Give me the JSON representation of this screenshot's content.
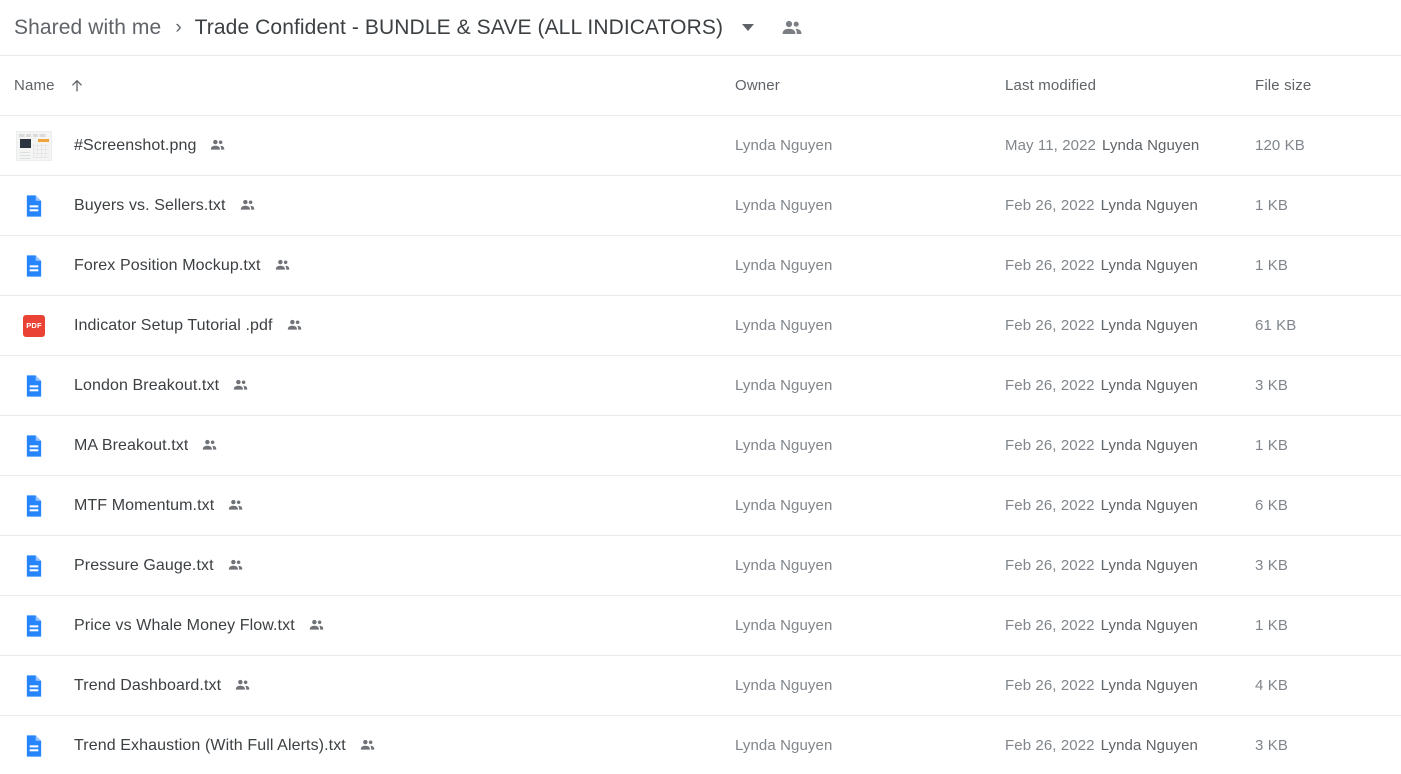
{
  "breadcrumb": {
    "parent": "Shared with me",
    "separator": "›",
    "current": "Trade Confident - BUNDLE & SAVE (ALL INDICATORS)",
    "caret_icon": "chevron-down-icon",
    "people_icon": "people-shared-icon"
  },
  "table": {
    "columns": {
      "name": "Name",
      "owner": "Owner",
      "last_modified": "Last modified",
      "file_size": "File size"
    },
    "sort": {
      "column": "Name",
      "direction": "ascending",
      "icon": "arrow-up-icon"
    },
    "rows": [
      {
        "name": "#Screenshot.png",
        "icon": "image-thumbnail",
        "shared_icon": "people-shared-icon",
        "owner": "Lynda Nguyen",
        "modified_date": "May 11, 2022",
        "modified_by": "Lynda Nguyen",
        "size": "120 KB"
      },
      {
        "name": "Buyers vs. Sellers.txt",
        "icon": "text-file-icon",
        "shared_icon": "people-shared-icon",
        "owner": "Lynda Nguyen",
        "modified_date": "Feb 26, 2022",
        "modified_by": "Lynda Nguyen",
        "size": "1 KB"
      },
      {
        "name": "Forex Position Mockup.txt",
        "icon": "text-file-icon",
        "shared_icon": "people-shared-icon",
        "owner": "Lynda Nguyen",
        "modified_date": "Feb 26, 2022",
        "modified_by": "Lynda Nguyen",
        "size": "1 KB"
      },
      {
        "name": "Indicator Setup Tutorial .pdf",
        "icon": "pdf-file-icon",
        "icon_label": "PDF",
        "shared_icon": "people-shared-icon",
        "owner": "Lynda Nguyen",
        "modified_date": "Feb 26, 2022",
        "modified_by": "Lynda Nguyen",
        "size": "61 KB"
      },
      {
        "name": "London Breakout.txt",
        "icon": "text-file-icon",
        "shared_icon": "people-shared-icon",
        "owner": "Lynda Nguyen",
        "modified_date": "Feb 26, 2022",
        "modified_by": "Lynda Nguyen",
        "size": "3 KB"
      },
      {
        "name": "MA Breakout.txt",
        "icon": "text-file-icon",
        "shared_icon": "people-shared-icon",
        "owner": "Lynda Nguyen",
        "modified_date": "Feb 26, 2022",
        "modified_by": "Lynda Nguyen",
        "size": "1 KB"
      },
      {
        "name": "MTF Momentum.txt",
        "icon": "text-file-icon",
        "shared_icon": "people-shared-icon",
        "owner": "Lynda Nguyen",
        "modified_date": "Feb 26, 2022",
        "modified_by": "Lynda Nguyen",
        "size": "6 KB"
      },
      {
        "name": "Pressure Gauge.txt",
        "icon": "text-file-icon",
        "shared_icon": "people-shared-icon",
        "owner": "Lynda Nguyen",
        "modified_date": "Feb 26, 2022",
        "modified_by": "Lynda Nguyen",
        "size": "3 KB"
      },
      {
        "name": "Price vs Whale Money Flow.txt",
        "icon": "text-file-icon",
        "shared_icon": "people-shared-icon",
        "owner": "Lynda Nguyen",
        "modified_date": "Feb 26, 2022",
        "modified_by": "Lynda Nguyen",
        "size": "1 KB"
      },
      {
        "name": "Trend Dashboard.txt",
        "icon": "text-file-icon",
        "shared_icon": "people-shared-icon",
        "owner": "Lynda Nguyen",
        "modified_date": "Feb 26, 2022",
        "modified_by": "Lynda Nguyen",
        "size": "4 KB"
      },
      {
        "name": "Trend Exhaustion (With Full Alerts).txt",
        "icon": "text-file-icon",
        "shared_icon": "people-shared-icon",
        "owner": "Lynda Nguyen",
        "modified_date": "Feb 26, 2022",
        "modified_by": "Lynda Nguyen",
        "size": "3 KB"
      }
    ]
  },
  "colors": {
    "text_file_blue": "#2684FC",
    "pdf_red": "#EA4335",
    "text_primary": "#3c4043",
    "text_secondary": "#5f6368",
    "text_muted": "#80868b",
    "divider": "#e8eaed"
  }
}
